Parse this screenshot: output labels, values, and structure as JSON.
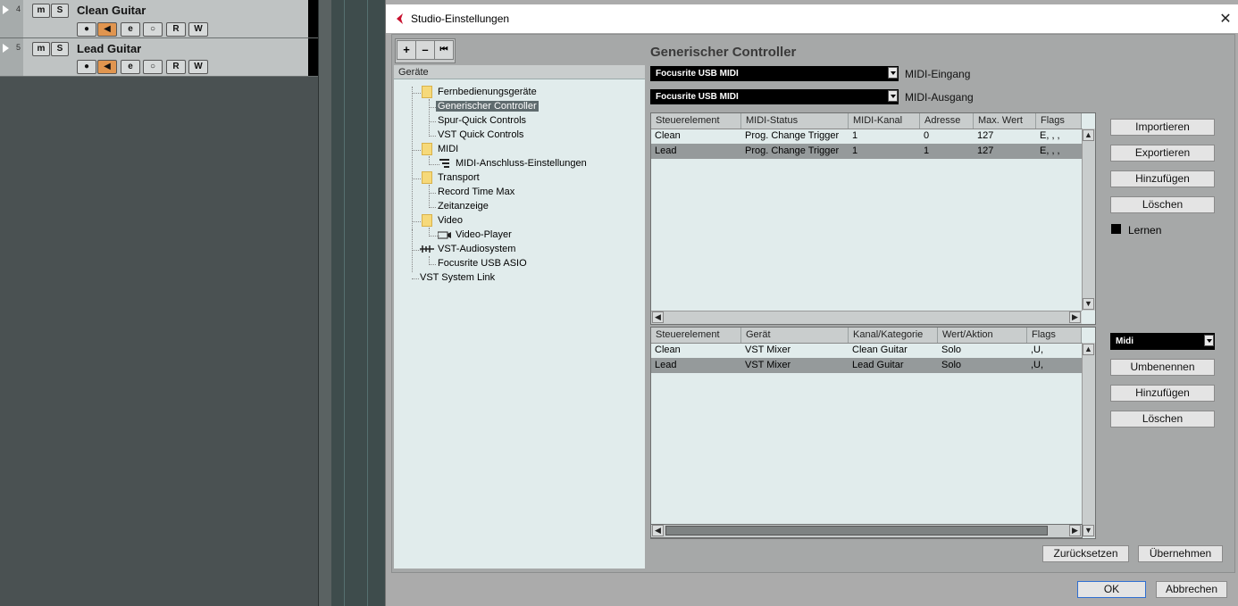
{
  "daw": {
    "tracks": [
      {
        "number": "4",
        "name": "Clean Guitar",
        "m": "m",
        "s": "S",
        "e": "e",
        "r": "R",
        "w": "W"
      },
      {
        "number": "5",
        "name": "Lead  Guitar",
        "m": "m",
        "s": "S",
        "e": "e",
        "r": "R",
        "w": "W"
      }
    ]
  },
  "dialog": {
    "title": "Studio-Einstellungen",
    "close": "✕",
    "toolbar": {
      "add": "+",
      "remove": "–",
      "reset": "⏮"
    },
    "tree": {
      "header": "Geräte",
      "items": [
        {
          "label": "Fernbedienungsgeräte"
        },
        {
          "label": "Generischer Controller"
        },
        {
          "label": "Spur-Quick Controls"
        },
        {
          "label": "VST Quick Controls"
        },
        {
          "label": "MIDI"
        },
        {
          "label": "MIDI-Anschluss-Einstellungen"
        },
        {
          "label": "Transport"
        },
        {
          "label": "Record Time Max"
        },
        {
          "label": "Zeitanzeige"
        },
        {
          "label": "Video"
        },
        {
          "label": "Video-Player"
        },
        {
          "label": "VST-Audiosystem"
        },
        {
          "label": "Focusrite USB ASIO"
        },
        {
          "label": "VST System Link"
        }
      ]
    },
    "panel": {
      "title": "Generischer Controller",
      "midi_in": {
        "value": "Focusrite USB MIDI",
        "label": "MIDI-Eingang"
      },
      "midi_out": {
        "value": "Focusrite USB MIDI",
        "label": "MIDI-Ausgang"
      },
      "table1": {
        "headers": [
          "Steuerelement",
          "MIDI-Status",
          "MIDI-Kanal",
          "Adresse",
          "Max. Wert",
          "Flags"
        ],
        "rows": [
          [
            "Clean",
            "Prog. Change Trigger",
            "1",
            "0",
            "127",
            "E, , ,"
          ],
          [
            "Lead",
            "Prog. Change Trigger",
            "1",
            "1",
            "127",
            "E, , ,"
          ]
        ]
      },
      "table2": {
        "headers": [
          "Steuerelement",
          "Gerät",
          "Kanal/Kategorie",
          "Wert/Aktion",
          "Flags"
        ],
        "rows": [
          [
            "Clean",
            "VST Mixer",
            "Clean Guitar",
            "Solo",
            ",U,"
          ],
          [
            "Lead",
            "VST Mixer",
            "Lead  Guitar",
            "Solo",
            ",U,"
          ]
        ]
      },
      "buttons": {
        "import": "Importieren",
        "export": "Exportieren",
        "add": "Hinzufügen",
        "delete": "Löschen",
        "learn": "Lernen",
        "bank": "Midi",
        "rename": "Umbenennen",
        "add2": "Hinzufügen",
        "delete2": "Löschen",
        "reset": "Zurücksetzen",
        "apply": "Übernehmen"
      }
    },
    "footer": {
      "ok": "OK",
      "cancel": "Abbrechen"
    }
  }
}
